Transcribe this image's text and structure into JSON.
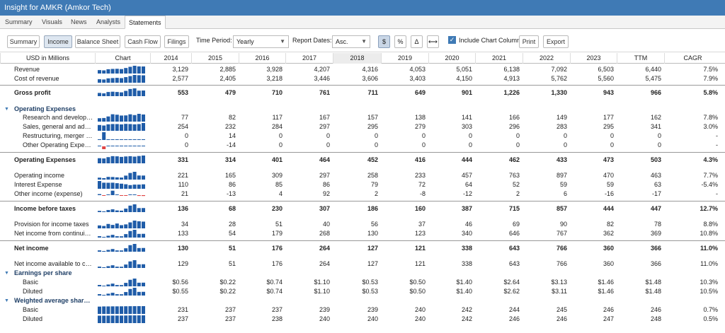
{
  "window_title": "Insight for AMKR (Amkor Tech)",
  "tabs": [
    {
      "label": "Summary"
    },
    {
      "label": "Visuals"
    },
    {
      "label": "News"
    },
    {
      "label": "Analysts"
    },
    {
      "label": "Statements"
    }
  ],
  "toolbar": {
    "summary": "Summary",
    "income": "Income",
    "balance_sheet": "Balance Sheet",
    "cash_flow": "Cash Flow",
    "filings": "Filings",
    "time_period_label": "Time Period:",
    "time_period_value": "Yearly",
    "report_dates_label": "Report Dates:",
    "report_dates_value": "Asc.",
    "dollar": "$",
    "percent": "%",
    "delta": "Δ",
    "arrows": "⟷",
    "include_chart_label": "Include Chart Column",
    "print": "Print",
    "export": "Export"
  },
  "table": {
    "headers": {
      "label": "USD in Millions",
      "chart": "Chart",
      "cols": [
        "2014",
        "2015",
        "2016",
        "2017",
        "2018",
        "2019",
        "2020",
        "2021",
        "2022",
        "2023",
        "TTM",
        "CAGR"
      ]
    },
    "rows": [
      {
        "label": "Revenue",
        "values": [
          "3,129",
          "2,885",
          "3,928",
          "4,207",
          "4,316",
          "4,053",
          "5,051",
          "6,138",
          "7,092",
          "6,503",
          "6,440",
          "7.5%"
        ],
        "spark": [
          3129,
          2885,
          3928,
          4207,
          4316,
          4053,
          5051,
          6138,
          7092,
          6503,
          6440
        ]
      },
      {
        "label": "Cost of revenue",
        "values": [
          "2,577",
          "2,405",
          "3,218",
          "3,446",
          "3,606",
          "3,403",
          "4,150",
          "4,913",
          "5,762",
          "5,560",
          "5,475",
          "7.9%"
        ],
        "spark": [
          2577,
          2405,
          3218,
          3446,
          3606,
          3403,
          4150,
          4913,
          5762,
          5560,
          5475
        ]
      },
      {
        "label": "Gross profit",
        "values": [
          "553",
          "479",
          "710",
          "761",
          "711",
          "649",
          "901",
          "1,226",
          "1,330",
          "943",
          "966",
          "5.8%"
        ],
        "spark": [
          553,
          479,
          710,
          761,
          711,
          649,
          901,
          1226,
          1330,
          943,
          966
        ]
      },
      {
        "label": "Operating Expenses",
        "values": []
      },
      {
        "label": "Research and development",
        "values": [
          "77",
          "82",
          "117",
          "167",
          "157",
          "138",
          "141",
          "166",
          "149",
          "177",
          "162",
          "7.8%"
        ],
        "spark": [
          77,
          82,
          117,
          167,
          157,
          138,
          141,
          166,
          149,
          177,
          162
        ]
      },
      {
        "label": "Sales, general and admi...",
        "values": [
          "254",
          "232",
          "284",
          "297",
          "295",
          "279",
          "303",
          "296",
          "283",
          "295",
          "341",
          "3.0%"
        ],
        "spark": [
          254,
          232,
          284,
          297,
          295,
          279,
          303,
          296,
          283,
          295,
          341
        ]
      },
      {
        "label": "Restructuring, merger an...",
        "values": [
          "0",
          "14",
          "0",
          "0",
          "0",
          "0",
          "0",
          "0",
          "0",
          "0",
          "0",
          "-"
        ],
        "spark": [
          0,
          14,
          0,
          0,
          0,
          0,
          0,
          0,
          0,
          0,
          0
        ]
      },
      {
        "label": "Other Operating Expenses",
        "values": [
          "0",
          "-14",
          "0",
          "0",
          "0",
          "0",
          "0",
          "0",
          "0",
          "0",
          "0",
          "-"
        ],
        "spark": [
          0,
          -14,
          0,
          0,
          0,
          0,
          0,
          0,
          0,
          0,
          0
        ]
      },
      {
        "label": "Operating Expenses",
        "values": [
          "331",
          "314",
          "401",
          "464",
          "452",
          "416",
          "444",
          "462",
          "433",
          "473",
          "503",
          "4.3%"
        ],
        "spark": [
          331,
          314,
          401,
          464,
          452,
          416,
          444,
          462,
          433,
          473,
          503
        ]
      },
      {
        "label": "Operating income",
        "values": [
          "221",
          "165",
          "309",
          "297",
          "258",
          "233",
          "457",
          "763",
          "897",
          "470",
          "463",
          "7.7%"
        ],
        "spark": [
          221,
          165,
          309,
          297,
          258,
          233,
          457,
          763,
          897,
          470,
          463
        ]
      },
      {
        "label": "Interest Expense",
        "values": [
          "110",
          "86",
          "85",
          "86",
          "79",
          "72",
          "64",
          "52",
          "59",
          "59",
          "63",
          "-5.4%"
        ],
        "spark": [
          110,
          86,
          85,
          86,
          79,
          72,
          64,
          52,
          59,
          59,
          63
        ]
      },
      {
        "label": "Other income (expense)",
        "values": [
          "21",
          "-13",
          "4",
          "92",
          "2",
          "-8",
          "-12",
          "2",
          "6",
          "-16",
          "-17",
          "-"
        ],
        "spark": [
          21,
          -13,
          4,
          92,
          2,
          -8,
          -12,
          2,
          6,
          -16,
          -17
        ]
      },
      {
        "label": "Income before taxes",
        "values": [
          "136",
          "68",
          "230",
          "307",
          "186",
          "160",
          "387",
          "715",
          "857",
          "444",
          "447",
          "12.7%"
        ],
        "spark": [
          136,
          68,
          230,
          307,
          186,
          160,
          387,
          715,
          857,
          444,
          447
        ]
      },
      {
        "label": "Provision for income taxes",
        "values": [
          "34",
          "28",
          "51",
          "40",
          "56",
          "37",
          "46",
          "69",
          "90",
          "82",
          "78",
          "8.8%"
        ],
        "spark": [
          34,
          28,
          51,
          40,
          56,
          37,
          46,
          69,
          90,
          82,
          78
        ]
      },
      {
        "label": "Net income from continuing ...",
        "values": [
          "133",
          "54",
          "179",
          "268",
          "130",
          "123",
          "340",
          "646",
          "767",
          "362",
          "369",
          "10.8%"
        ],
        "spark": [
          133,
          54,
          179,
          268,
          130,
          123,
          340,
          646,
          767,
          362,
          369
        ]
      },
      {
        "label": "Net income",
        "values": [
          "130",
          "51",
          "176",
          "264",
          "127",
          "121",
          "338",
          "643",
          "766",
          "360",
          "366",
          "11.0%"
        ],
        "spark": [
          130,
          51,
          176,
          264,
          127,
          121,
          338,
          643,
          766,
          360,
          366
        ]
      },
      {
        "label": "Net income available to com...",
        "values": [
          "129",
          "51",
          "176",
          "264",
          "127",
          "121",
          "338",
          "643",
          "766",
          "360",
          "366",
          "11.0%"
        ],
        "spark": [
          129,
          51,
          176,
          264,
          127,
          121,
          338,
          643,
          766,
          360,
          366
        ]
      },
      {
        "label": "Earnings per share",
        "values": []
      },
      {
        "label": "Basic",
        "values": [
          "$0.56",
          "$0.22",
          "$0.74",
          "$1.10",
          "$0.53",
          "$0.50",
          "$1.40",
          "$2.64",
          "$3.13",
          "$1.46",
          "$1.48",
          "10.3%"
        ],
        "spark": [
          0.56,
          0.22,
          0.74,
          1.1,
          0.53,
          0.5,
          1.4,
          2.64,
          3.13,
          1.46,
          1.48
        ]
      },
      {
        "label": "Diluted",
        "values": [
          "$0.55",
          "$0.22",
          "$0.74",
          "$1.10",
          "$0.53",
          "$0.50",
          "$1.40",
          "$2.62",
          "$3.11",
          "$1.46",
          "$1.48",
          "10.5%"
        ],
        "spark": [
          0.55,
          0.22,
          0.74,
          1.1,
          0.53,
          0.5,
          1.4,
          2.62,
          3.11,
          1.46,
          1.48
        ]
      },
      {
        "label": "Weighted average shares ...",
        "values": []
      },
      {
        "label": "Basic",
        "values": [
          "231",
          "237",
          "237",
          "239",
          "239",
          "240",
          "242",
          "244",
          "245",
          "246",
          "246",
          "0.7%"
        ],
        "spark": [
          231,
          237,
          237,
          239,
          239,
          240,
          242,
          244,
          245,
          246,
          246
        ]
      },
      {
        "label": "Diluted",
        "values": [
          "237",
          "237",
          "238",
          "240",
          "240",
          "240",
          "242",
          "246",
          "246",
          "247",
          "248",
          "0.5%"
        ],
        "spark": [
          237,
          237,
          238,
          240,
          240,
          240,
          242,
          246,
          246,
          247,
          248
        ]
      }
    ]
  },
  "colors": {
    "positive": "#1f5ca8",
    "negative": "#e04545",
    "header": "#3f7ab5"
  }
}
